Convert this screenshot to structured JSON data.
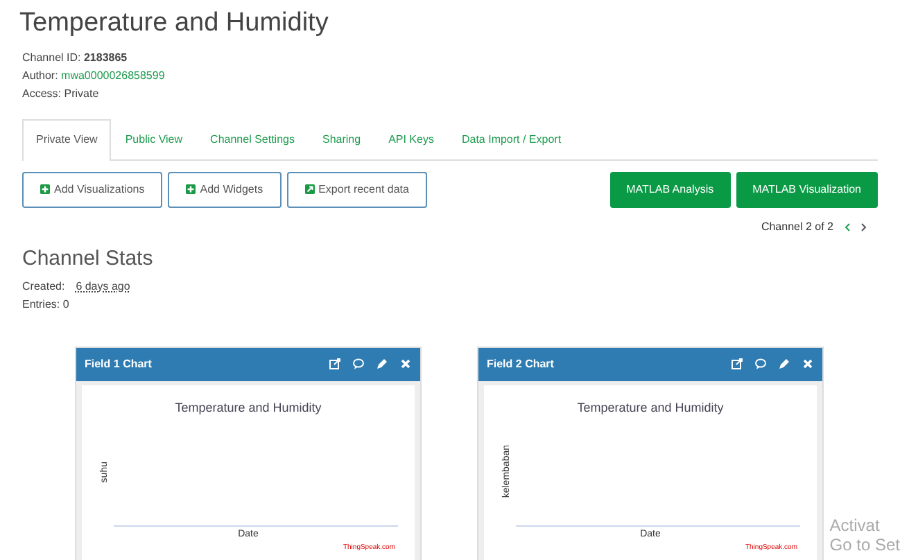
{
  "title": "Temperature and Humidity",
  "channel_info": [
    {
      "label": "Channel ID:",
      "value": "2183865",
      "kind": "bold"
    },
    {
      "label": "Author:",
      "value": "mwa0000026858599",
      "kind": "link"
    },
    {
      "label": "Access:",
      "value": "Private",
      "kind": "plain"
    }
  ],
  "tabs": [
    {
      "label": "Private View",
      "selected": true
    },
    {
      "label": "Public View",
      "selected": false
    },
    {
      "label": "Channel Settings",
      "selected": false
    },
    {
      "label": "Sharing",
      "selected": false
    },
    {
      "label": "API Keys",
      "selected": false
    },
    {
      "label": "Data Import / Export",
      "selected": false
    }
  ],
  "left_buttons": [
    {
      "label": "Add Visualizations",
      "kind": "add"
    },
    {
      "label": "Add Widgets",
      "kind": "add"
    },
    {
      "label": "Export recent data",
      "kind": "export"
    }
  ],
  "right_buttons": [
    "MATLAB Analysis",
    "MATLAB Visualization"
  ],
  "channel_nav": "Channel 2 of 2",
  "stats": {
    "heading": "Channel Stats",
    "created_label": "Created:",
    "created_value": "6 days ago",
    "entries": "Entries: 0"
  },
  "charts": [
    {
      "header": "Field 1 Chart",
      "title": "Temperature and Humidity",
      "ylabel": "suhu",
      "xlabel": "Date",
      "credit": "ThingSpeak.com"
    },
    {
      "header": "Field 2 Chart",
      "title": "Temperature and Humidity",
      "ylabel": "kelembaban",
      "xlabel": "Date",
      "credit": "ThingSpeak.com"
    }
  ],
  "os_notice": [
    "Activat",
    "Go to Set"
  ]
}
